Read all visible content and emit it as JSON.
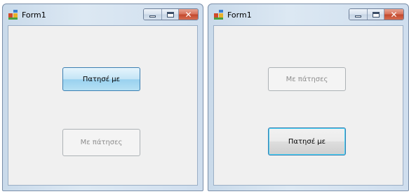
{
  "windows": [
    {
      "title": "Form1",
      "buttons": {
        "top": {
          "label": "Πατησέ με",
          "state": "hover"
        },
        "bottom": {
          "label": "Με πάτησες",
          "state": "disabled"
        }
      }
    },
    {
      "title": "Form1",
      "buttons": {
        "top": {
          "label": "Με πάτησες",
          "state": "disabled"
        },
        "bottom": {
          "label": "Πατησέ με",
          "state": "focused"
        }
      }
    }
  ],
  "icons": {
    "app": "form-app-icon",
    "minimize": "minimize-icon",
    "maximize": "maximize-icon",
    "close": "close-icon"
  },
  "colors": {
    "close_button": "#c44a2f",
    "hover_button": "#98d1ef",
    "focus_border": "#3c7fb1"
  }
}
